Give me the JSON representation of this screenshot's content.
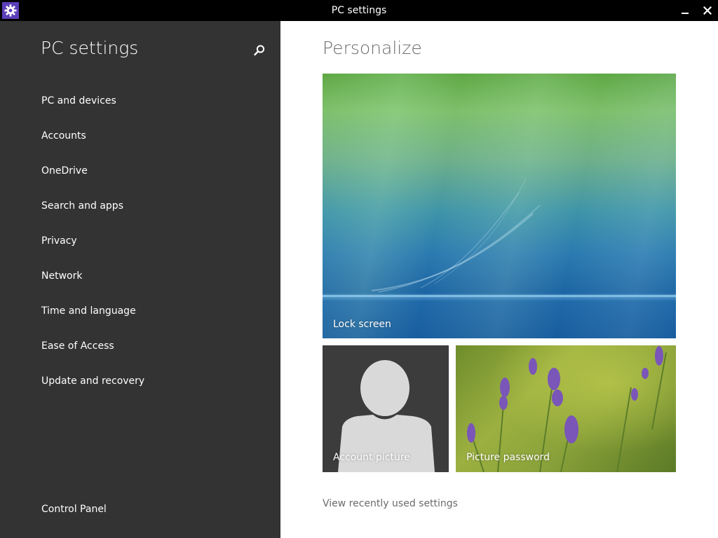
{
  "window": {
    "title": "PC settings",
    "app_icon": "gear-icon",
    "minimize_icon": "minimize-icon",
    "close_icon": "close-icon"
  },
  "sidebar": {
    "title": "PC settings",
    "search_icon": "search-icon",
    "items": [
      {
        "label": "PC and devices"
      },
      {
        "label": "Accounts"
      },
      {
        "label": "OneDrive"
      },
      {
        "label": "Search and apps"
      },
      {
        "label": "Privacy"
      },
      {
        "label": "Network"
      },
      {
        "label": "Time and language"
      },
      {
        "label": "Ease of Access"
      },
      {
        "label": "Update and recovery"
      }
    ],
    "footer_link": "Control Panel"
  },
  "main": {
    "title": "Personalize",
    "tiles": {
      "lock_screen": "Lock screen",
      "account_picture": "Account picture",
      "picture_password": "Picture password"
    },
    "recent_link": "View recently used settings"
  },
  "colors": {
    "titlebar_bg": "#000000",
    "sidebar_bg": "#333333",
    "accent": "#5b3fb8",
    "main_bg": "#ffffff",
    "muted_text": "#6b6b6b"
  }
}
